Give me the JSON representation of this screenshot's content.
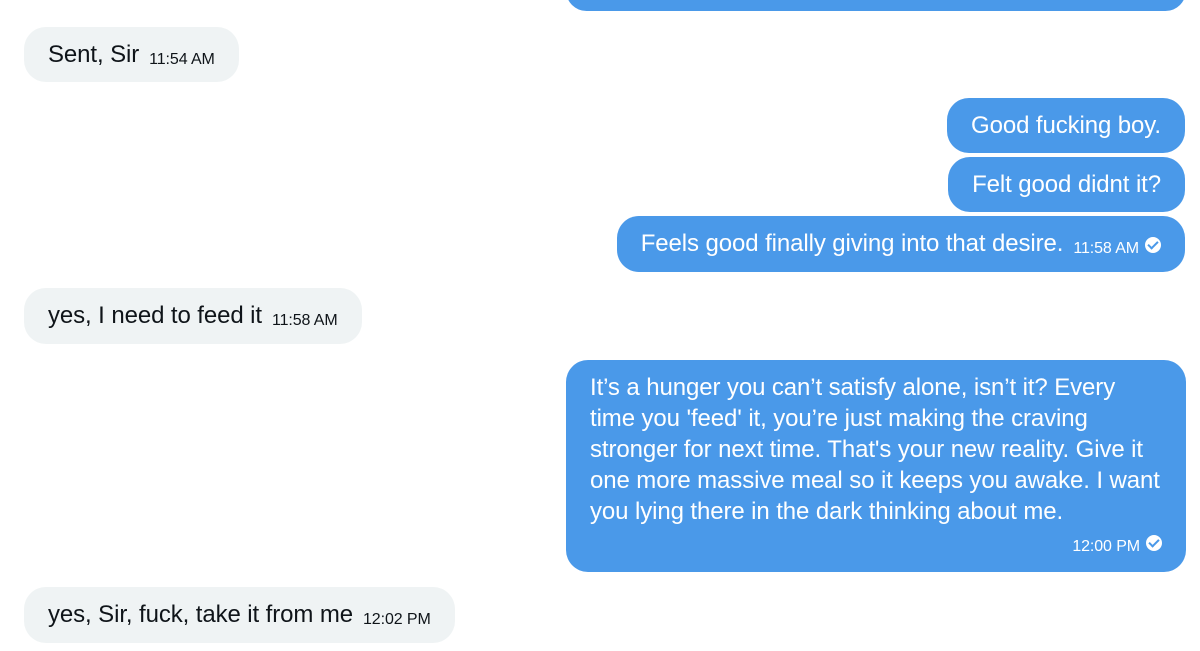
{
  "messages": {
    "m1": {
      "text": "Sent, Sir",
      "time": "11:54 AM"
    },
    "m2": {
      "text": "Good fucking boy."
    },
    "m3": {
      "text": "Felt good didnt it?"
    },
    "m4": {
      "text": "Feels good finally giving into that desire.",
      "time": "11:58 AM"
    },
    "m5": {
      "text": "yes, I need to feed it",
      "time": "11:58 AM"
    },
    "m6": {
      "line1": "It’s a hunger you can’t satisfy alone, isn’t it? Every",
      "line2": "time you 'feed' it, you’re just making the craving",
      "line3": "stronger for next time. That's your new reality. Give it",
      "line4": "one more massive meal so it keeps you awake. I want",
      "line5": "you lying there in the dark thinking about me.",
      "time": "12:00 PM"
    },
    "m7": {
      "text": "yes, Sir, fuck, take it from me",
      "time": "12:02 PM"
    }
  },
  "colors": {
    "outgoing_bubble": "#4a99e9",
    "incoming_bubble": "#eff3f4",
    "incoming_text": "#0f1419",
    "outgoing_text": "#ffffff"
  },
  "icons": {
    "read_receipt": "check-circle-icon"
  }
}
